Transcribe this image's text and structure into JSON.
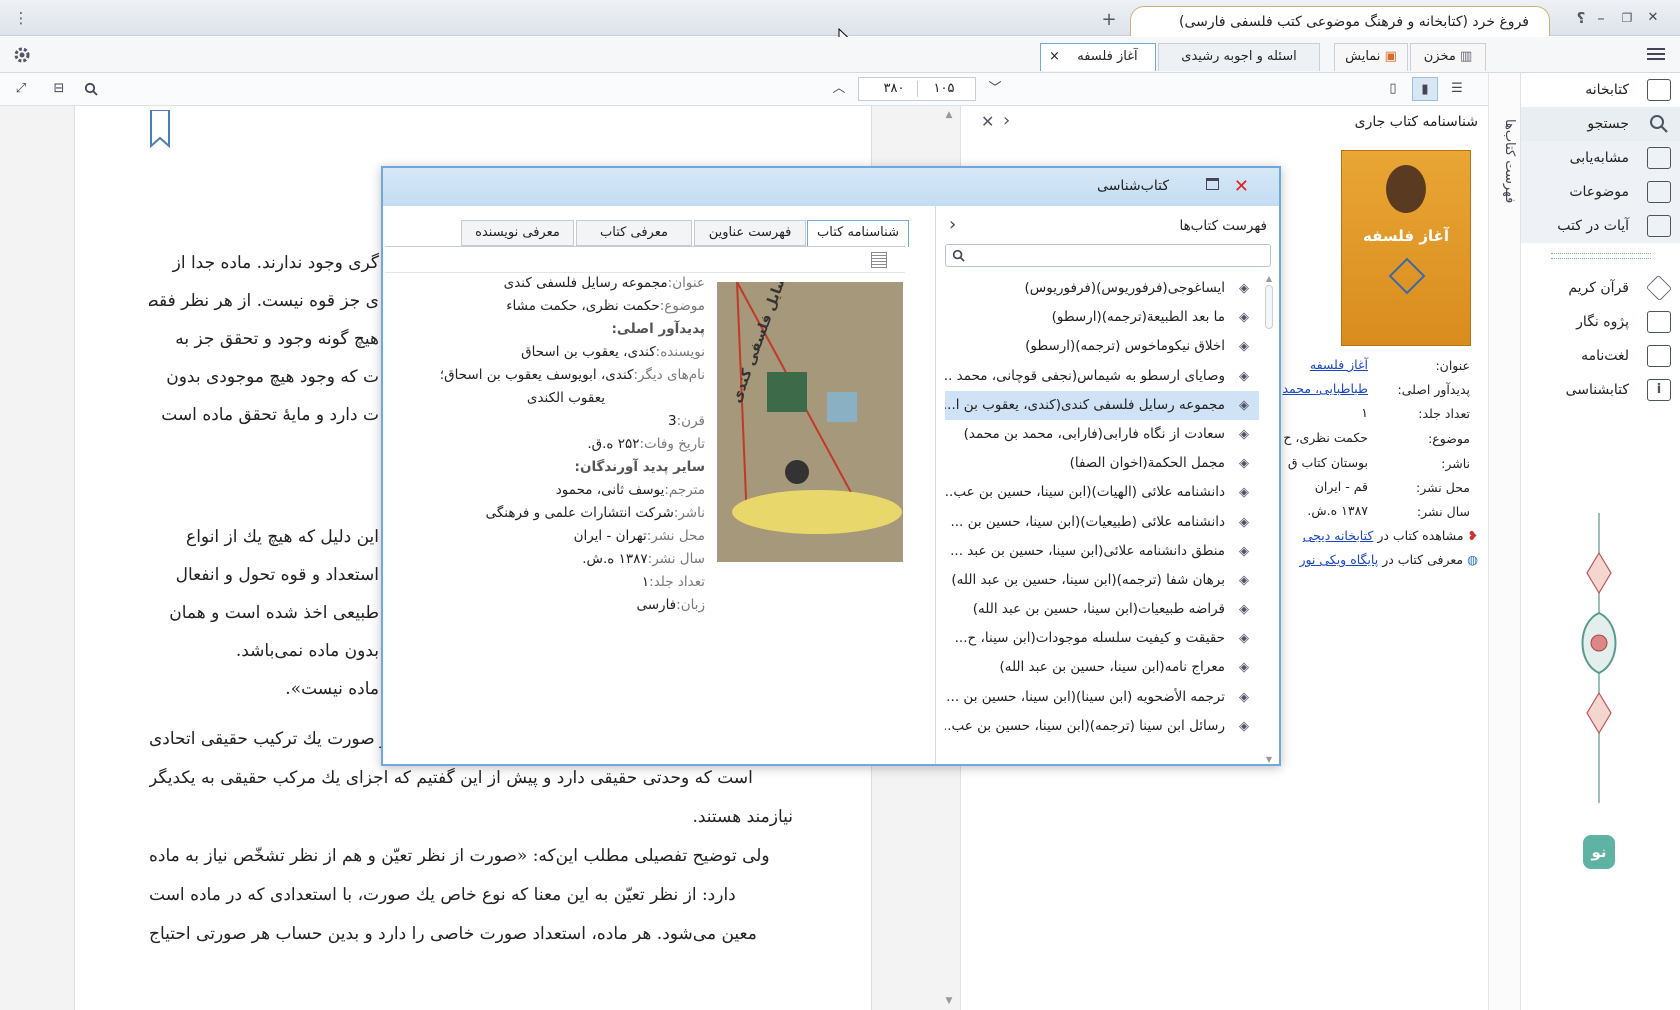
{
  "window": {
    "title": "فروغ خرد (کتابخانه و فرهنگ موضوعی کتب فلسفی فارسی)",
    "add_tab": "+",
    "help": "؟"
  },
  "tabs": {
    "storage": "مخزن",
    "display": "نمایش",
    "doc_tabs": [
      "اسئله و اجوبه رشیدی",
      "آغاز فلسفه"
    ],
    "close": "×"
  },
  "toolbar": {
    "page_current": "۱۰۵",
    "page_total": "۳۸۰"
  },
  "nav": {
    "items": [
      "کتابخانه",
      "جستجو",
      "مشابه‌یابی",
      "موضوعات",
      "آیات در کتب",
      "قرآن کریم",
      "پژوه نگار",
      "لغت‌نامه",
      "کتابشناسی"
    ],
    "vertical_label": "فهرست کتاب‌ها",
    "logo_text": "نو"
  },
  "book_info": {
    "header": "شناسنامه کتاب جاری",
    "cover_title": "آغاز فلسفه",
    "rows": [
      {
        "label": "عنوان:",
        "value": "آغاز فلسفه",
        "link": true
      },
      {
        "label": "پدیدآور اصلی:",
        "value": "طباطبایی، محمد",
        "link": true
      },
      {
        "label": "تعداد جلد:",
        "value": "۱"
      },
      {
        "label": "موضوع:",
        "value": "حکمت نظری، ح"
      },
      {
        "label": "ناشر:",
        "value": "بوستان کتاب ق"
      },
      {
        "label": "محل نشر:",
        "value": "قم - ایران"
      },
      {
        "label": "سال نشر:",
        "value": "۱۳۸۷ ه.ش."
      }
    ],
    "link1_prefix": "مشاهده کتاب در",
    "link1": "کتابخانه دیجی",
    "link2_prefix": "معرفی کتاب در",
    "link2": "پایگاه ویکی نور"
  },
  "reader": {
    "para1": [
      "گری وجود ندارند. ماده جدا از",
      "ی جز قوه نیست. از هر نظر فقط",
      "هیچ گونه وجود و تحقق جز به",
      "ت که وجود هیچ موجودی بدون",
      "ت دارد و مایهٔ تحقق ماده است"
    ],
    "para2": [
      "این دلیل که هیچ یك از انواع",
      "استعداد و قوه تحول و انفعال",
      "طبیعی اخذ شده است و همان",
      "بدون ماده نمی‌باشد.",
      "ماده نیست»."
    ],
    "para3": [
      "با یك بیان اجمالی مطلب ثابت می‌شود: ترکیب ماده و صورت یك ترکیب حقیقی اتحادی",
      "است که وحدتی حقیقی دارد و پیش از این گفتیم که اجزای یك مرکب حقیقی به یکدیگر",
      "نیازمند هستند.",
      "ولی توضیح تفصیلی مطلب این‌که: «صورت از نظر تعیّن و هم از نظر تشخّص نیاز به ماده",
      "دارد: از نظر تعیّن به این معنا که نوع خاص یك صورت، با استعدادی که در ماده است",
      "معین می‌شود. هر ماده، استعداد صورت خاصی را دارد و بدین حساب هر صورتی احتیاج"
    ]
  },
  "dialog": {
    "title": "کتاب‌شناسی",
    "list_header": "فهرست کتاب‌ها",
    "search_placeholder": "",
    "tabs": [
      "شناسنامه کتاب",
      "فهرست عناوین",
      "معرفی کتاب",
      "معرفی نویسنده"
    ],
    "books": [
      "ایساغوجی(فرفوریوس)(فرفوریوس)",
      "ما بعد الطبیعة(ترجمه)(ارسطو)",
      "اخلاق نیکوماخوس (ترجمه)(ارسطو)",
      "وصایای ارسطو به شیماس(نجفی قوچانی، محمد ...",
      "مجموعه رسایل فلسفی کندی(کندی، یعقوب بن ا...",
      "سعادت از نگاه فارابی(فارابی، محمد بن محمد)",
      "مجمل الحکمة(اخوان الصفا)",
      "دانشنامه علائی (الهیات)(ابن سینا، حسین بن عب...",
      "دانشنامه علائی (طبیعیات)(ابن سینا، حسین بن ...",
      "منطق دانشنامه علائی(ابن سینا، حسین بن عبد ...",
      "برهان شفا (ترجمه)(ابن سینا، حسین بن عبد الله)",
      "قراضه طبیعیات(ابن سینا، حسین بن عبد الله)",
      "حقیقت و کیفیت سلسله موجودات(ابن سینا، ح...",
      "معراج نامه(ابن سینا، حسین بن عبد الله)",
      "ترجمه الأضحویه (ابن سینا)(ابن سینا، حسین بن ...",
      "رسائل ابن سینا (ترجمه)(ابن سینا، حسین بن عب..."
    ],
    "selected_index": 4,
    "meta": {
      "title_label": "عنوان:",
      "title": "مجموعه رسایل فلسفی کندی",
      "subject_label": "موضوع:",
      "subject": "حکمت نظری، حکمت مشاء",
      "creators_header": "پدیدآور اصلی:",
      "author_label": "نویسنده:",
      "author": "کندی، یعقوب بن اسحاق",
      "othernames_label": "نام‌های دیگر:",
      "othernames": "کندی، ابویوسف یعقوب بن اسحاق؛",
      "othernames2": "یعقوب الکندی",
      "century_label": "قرن:",
      "century": "3",
      "death_label": "تاریخ وفات:",
      "death": "۲۵۲ ه.ق.",
      "others_header": "سایر پدید آورندگان:",
      "translator_label": "مترجم:",
      "translator": "یوسف ثانی، محمود",
      "publisher_label": "ناشر:",
      "publisher": "شرکت انتشارات علمی و فرهنگی",
      "place_label": "محل نشر:",
      "place": "تهران - ایران",
      "year_label": "سال نشر:",
      "year": "۱۳۸۷ ه.ش.",
      "volumes_label": "تعداد جلد:",
      "volumes": "۱",
      "lang_label": "زبان:",
      "lang": "فارسی"
    },
    "cover_text": "مجموعه رسایل فلسفی کندی"
  },
  "colors": {
    "accent": "#6fa8dc",
    "link": "#1a45c7",
    "selected_row": "#cfe2f6"
  }
}
